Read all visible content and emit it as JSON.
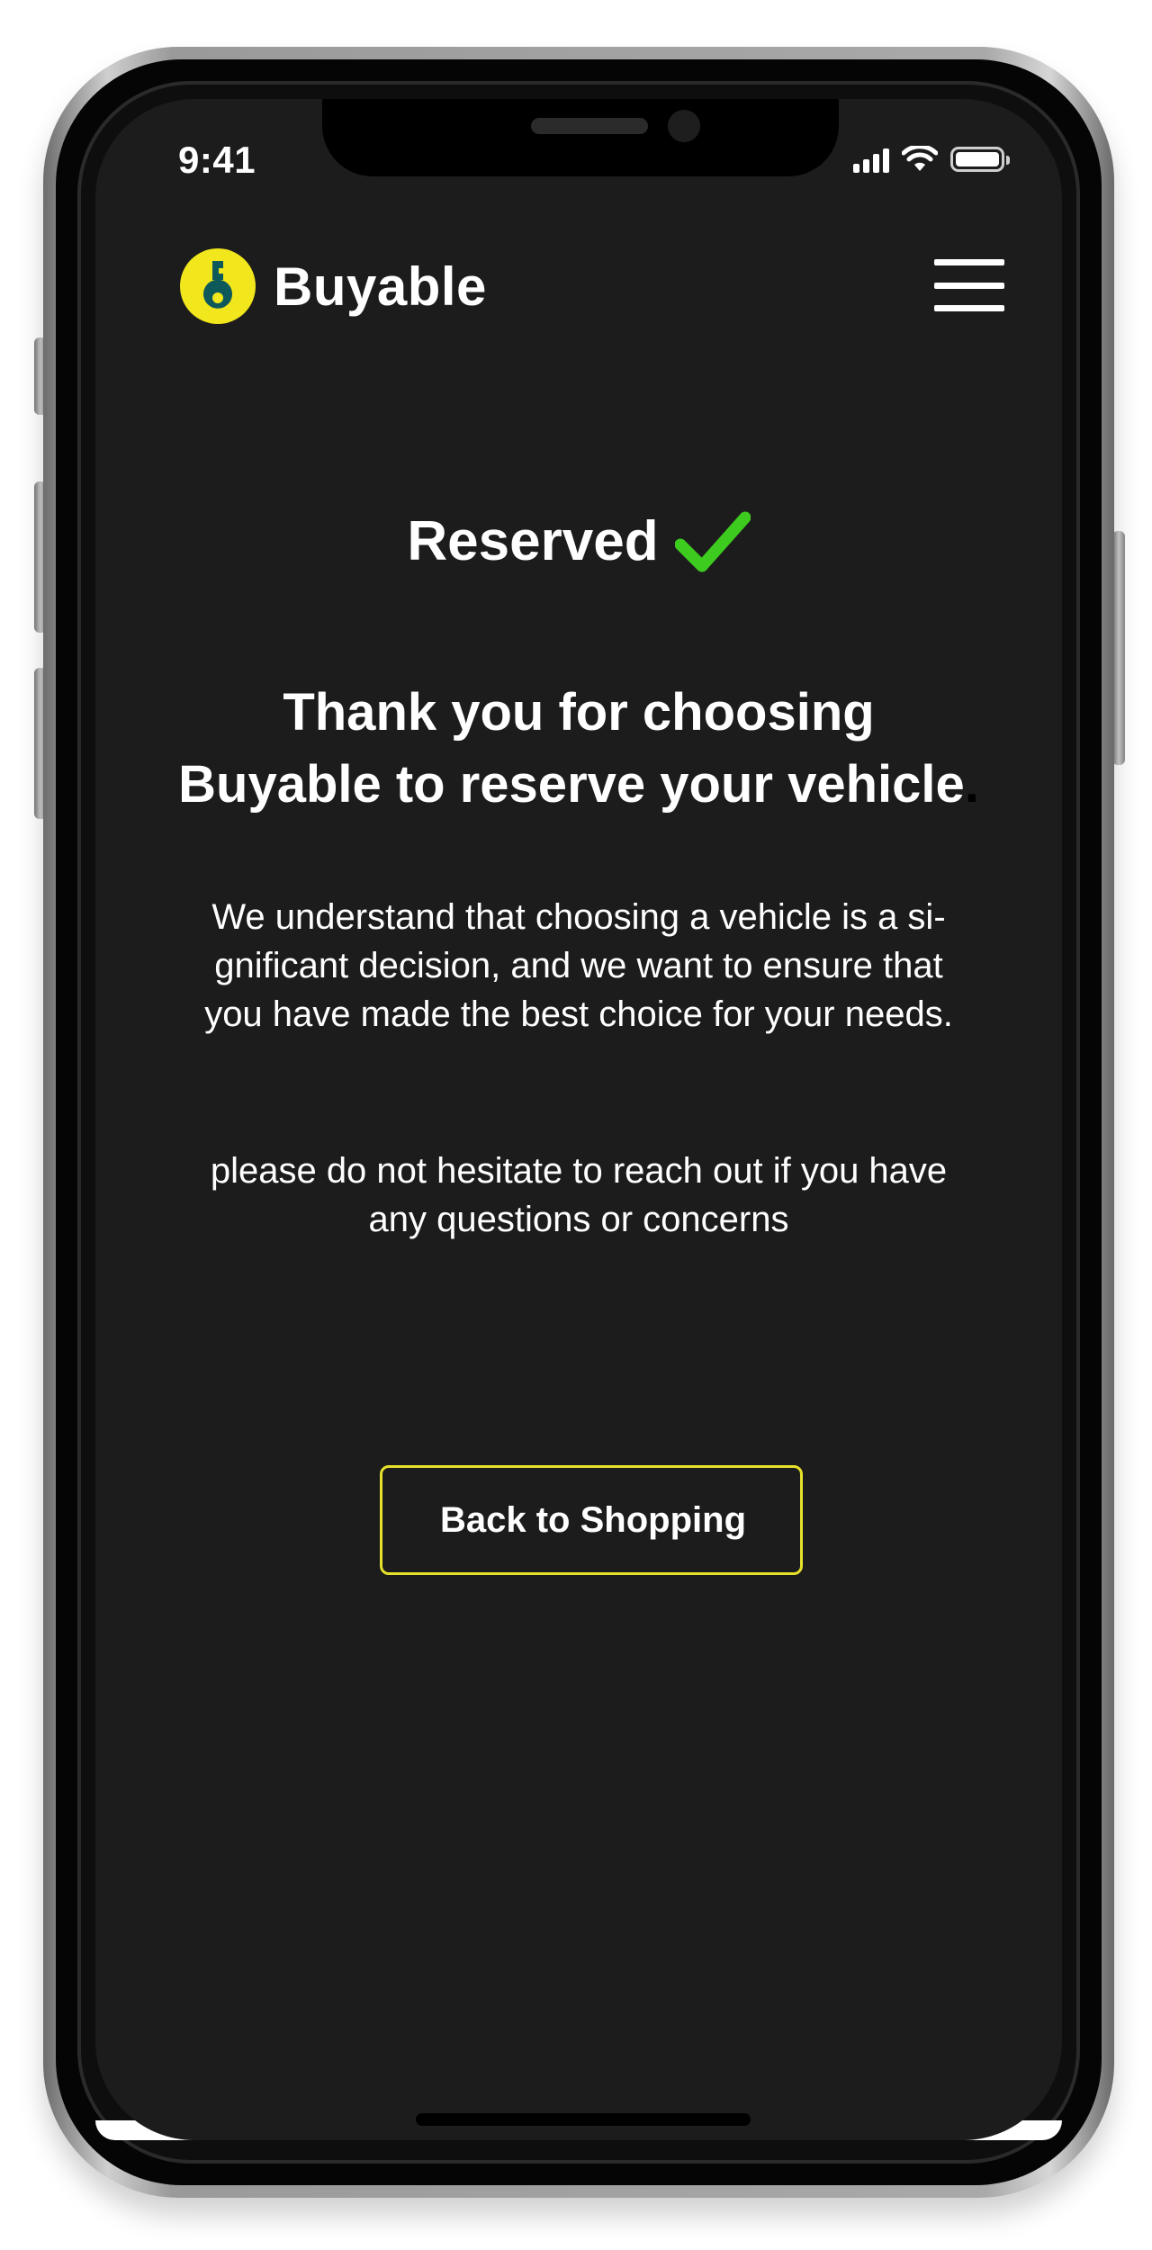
{
  "status_bar": {
    "time": "9:41",
    "icons": [
      "cellular-signal-icon",
      "wifi-icon",
      "battery-icon"
    ]
  },
  "header": {
    "logo_icon": "key-in-circle-icon",
    "brand": "Buyable",
    "menu_icon": "hamburger-menu-icon"
  },
  "confirmation": {
    "title": "Reserved",
    "title_icon": "checkmark-icon",
    "heading_line1": "Thank you for choosing",
    "heading_line2": "Buyable to reserve your vehicle",
    "heading_trailing": ".",
    "paragraph1_line1": "We understand that choosing a vehicle is a si-",
    "paragraph1_line2": "gnificant decision, and we want to ensure that",
    "paragraph1_line3": "you have made the best choice for your needs.",
    "paragraph2_line1": "please do not hesitate to reach out if you have",
    "paragraph2_line2": "any questions or concerns",
    "button_label": "Back to Shopping"
  },
  "colors": {
    "background": "#1c1c1c",
    "accent_yellow": "#e6e12a",
    "logo_yellow": "#f2e61c",
    "logo_teal": "#0e5a5a",
    "check_green": "#3ecb1f",
    "text": "#ffffff"
  }
}
